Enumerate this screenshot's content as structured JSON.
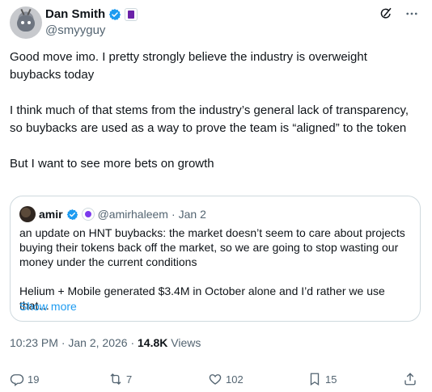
{
  "author": {
    "display_name": "Dan Smith",
    "handle": "@smyyguy"
  },
  "tweet": {
    "paragraphs": [
      "Good move imo. I pretty strongly believe the industry is overweight buybacks today",
      "I think much of that stems from the industry’s general lack of transparency, so buybacks are used as a way to prove the team is “aligned” to the token",
      "But I want to see more bets on growth"
    ]
  },
  "quote": {
    "name": "amir",
    "handle": "@amirhaleem",
    "separator": "·",
    "date": "Jan 2",
    "paragraphs": [
      "an update on HNT buybacks: the market doesn’t seem to care about projects buying their tokens back off the market, so we are going to stop wasting our money under the current conditions",
      "Helium + Mobile generated $3.4M in October alone and I’d rather we use that…"
    ],
    "show_more": "Show more"
  },
  "meta": {
    "time": "10:23 PM",
    "separator": "·",
    "date": "Jan 2, 2026",
    "separator2": "·",
    "views_count": "14.8K",
    "views_label": "Views"
  },
  "actions": {
    "replies": "19",
    "reposts": "7",
    "likes": "102",
    "bookmarks": "15"
  },
  "colors": {
    "accent": "#1d9bf0",
    "muted": "#536471",
    "border": "#cfd9de"
  },
  "icons": [
    "verified-badge-icon",
    "grok-icon",
    "more-icon",
    "reply-icon",
    "repost-icon",
    "like-icon",
    "bookmark-icon",
    "share-icon"
  ]
}
